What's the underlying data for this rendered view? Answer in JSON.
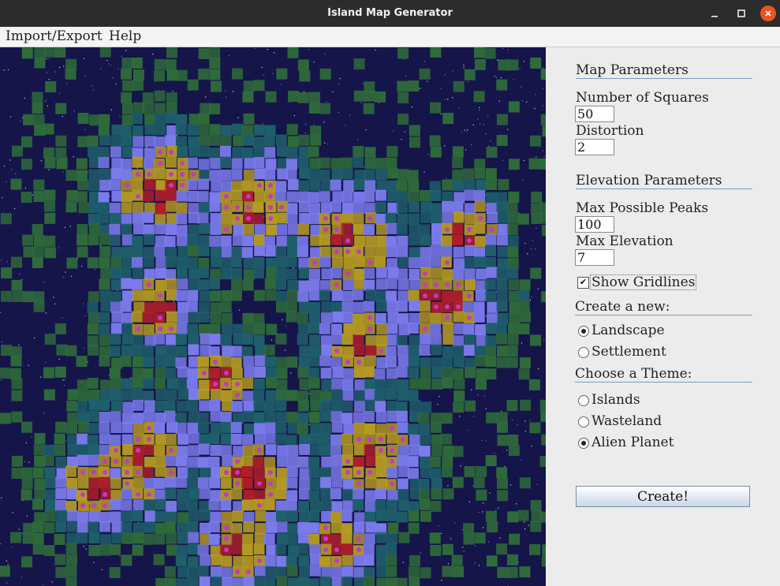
{
  "window": {
    "title": "Island Map Generator"
  },
  "menu": {
    "items": [
      "Import/Export",
      "Help"
    ]
  },
  "map": {
    "theme": "Alien Planet",
    "grid_size": 50,
    "colors": {
      "space": "#15154a",
      "shore": "#2f6b3a",
      "lowland": "#1f5f6b",
      "plain": "#7b7bec",
      "plateau": "#b59a22",
      "peak": "#b01e2a",
      "crystal": "#c03cc0"
    }
  },
  "panel": {
    "map_params": {
      "title": "Map Parameters",
      "squares_label": "Number of Squares",
      "squares_value": "50",
      "distortion_label": "Distortion",
      "distortion_value": "2"
    },
    "elevation_params": {
      "title": "Elevation Parameters",
      "peaks_label": "Max Possible Peaks",
      "peaks_value": "100",
      "elevation_label": "Max Elevation",
      "elevation_value": "7"
    },
    "gridlines": {
      "label": "Show Gridlines",
      "checked": true,
      "check_glyph": "✔"
    },
    "create_new": {
      "title": "Create a new:",
      "options": [
        "Landscape",
        "Settlement"
      ],
      "selected": "Landscape"
    },
    "theme": {
      "title": "Choose a Theme:",
      "options": [
        "Islands",
        "Wasteland",
        "Alien Planet"
      ],
      "selected": "Alien Planet"
    },
    "create_button": "Create!"
  }
}
